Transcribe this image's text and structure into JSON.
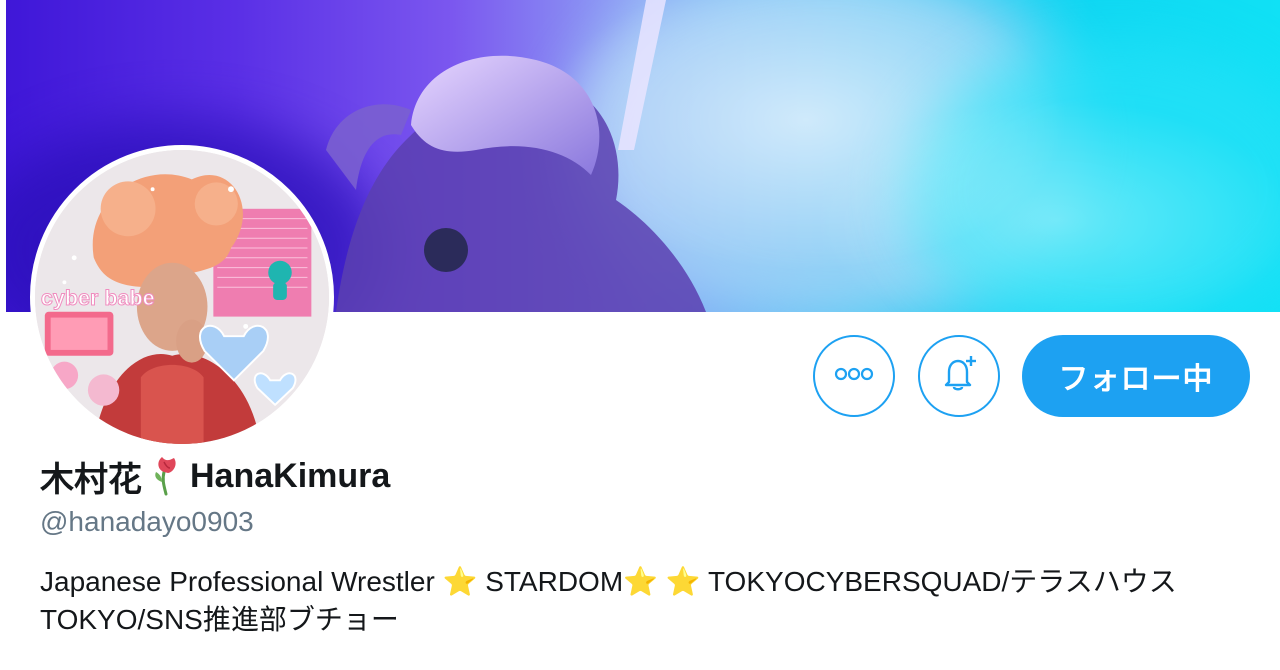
{
  "profile": {
    "display_name": "木村花",
    "display_name_latin": "HanaKimura",
    "name_emoji_icon": "wilted-rose-icon",
    "handle": "@hanadayo0903",
    "bio": {
      "part1": "Japanese Professional Wrestler ",
      "star1": "⭐",
      "part2": " STARDOM",
      "star2": "⭐",
      "part3": " ",
      "star3": "⭐",
      "part4": "  TOKYOCYBERSQUAD/テラスハウスTOKYO/SNS推進部ブチョー"
    },
    "avatar_sticker_text": "cyber babe"
  },
  "actions": {
    "more_icon": "more-dots-icon",
    "notify_icon": "bell-plus-icon",
    "follow_label": "フォロー中"
  },
  "colors": {
    "accent": "#1da1f2",
    "handle_gray": "#657786",
    "text_dark": "#14171a",
    "star_yellow": "#f5b400"
  }
}
